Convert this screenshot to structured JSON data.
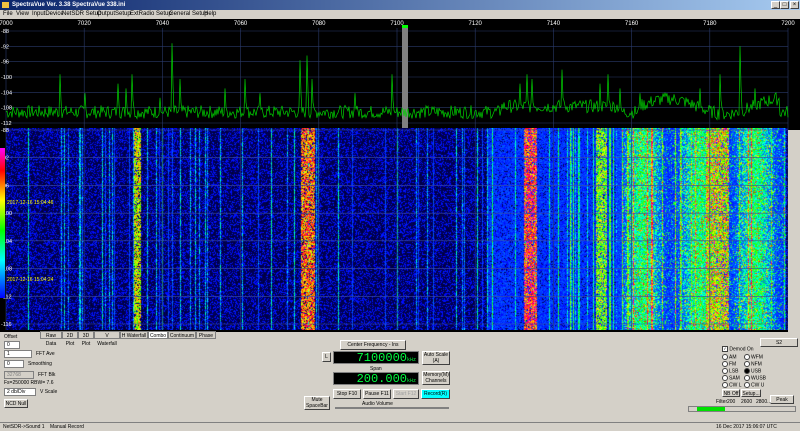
{
  "window": {
    "title": "SpectraVue Ver. 3.38  SpectraVue 338.ini",
    "minimize": "_",
    "maximize": "□",
    "close": "×"
  },
  "menu": [
    "File",
    "View",
    "InputDevice",
    "NetSDR Setup",
    "OutputSetup",
    "ExtRadio Setup",
    "General Setup",
    "Help"
  ],
  "spectrum": {
    "freq_ticks": [
      "7000",
      "7020",
      "7040",
      "7060",
      "7080",
      "7100",
      "7120",
      "7140",
      "7160",
      "7180",
      "7200"
    ],
    "level_ticks": [
      "-88",
      "-92",
      "-96",
      "-100",
      "-104",
      "-108",
      "-112"
    ],
    "trace_color": "#00d000",
    "marker_color": "#808080"
  },
  "waterfall": {
    "level_ticks": [
      "-88",
      "-92",
      "-96",
      "-100",
      "-104",
      "-108",
      "-112",
      "-116"
    ],
    "timestamps": [
      "2017-12-16 15:04:46",
      "2017-12-16 15:04:24"
    ],
    "timestamp_color": "#ffff00"
  },
  "tabs": [
    "Raw Data",
    "2D Plot",
    "3D Plot",
    "V Waterfall",
    "H Waterfall",
    "Combo",
    "Continuum",
    "Phase"
  ],
  "active_tab": "Combo",
  "left_panel": {
    "offset_label": "Offset",
    "offset_value": "0",
    "fft_ave_value": "1",
    "fft_ave_label": "FFT Ave",
    "smoothing_value": "0",
    "smoothing_label": "Smoothing",
    "fft_blk_value": "32768",
    "fft_blk_label": "FFT Blk",
    "fs_line": "Fs=250000 RBW= 7.6",
    "vscale_value": "2 db/Div",
    "vscale_label": "V Scale",
    "ncd_null": "NCD Null"
  },
  "center_panel": {
    "center_freq_btn": "Center Frequency - Ins",
    "l_btn": "L",
    "frequency": "7100000",
    "freq_unit": "kHz",
    "span_label": "Span",
    "span": "200.000",
    "span_unit": "kHz",
    "auto_scale": "Auto Scale (A)",
    "memory": "Memory(M) Channels",
    "mute": "Mute SpaceBar",
    "stop": "Stop F10",
    "pause": "Pause F11",
    "start": "Start F12",
    "record": "Record(R)",
    "audio_volume": "Audio Volume"
  },
  "demod": {
    "s2": "S2",
    "demod_on": "Demod On",
    "modes": [
      "AM",
      "WFM",
      "FM",
      "NFM",
      "LSB",
      "USB",
      "SAM",
      "WUSB",
      "CW L",
      "CW U"
    ],
    "selected_mode": "USB",
    "nb_off": "NB Off",
    "setup": "Setup...",
    "peak": "Peak",
    "filter_label": "Filter",
    "filters": [
      "200",
      "2600",
      "2800..."
    ]
  },
  "status": {
    "left": "NetSDR->Sound 1",
    "record": "Manual Record",
    "datetime": "16 Dec 2017   15:06:07 UTC"
  }
}
